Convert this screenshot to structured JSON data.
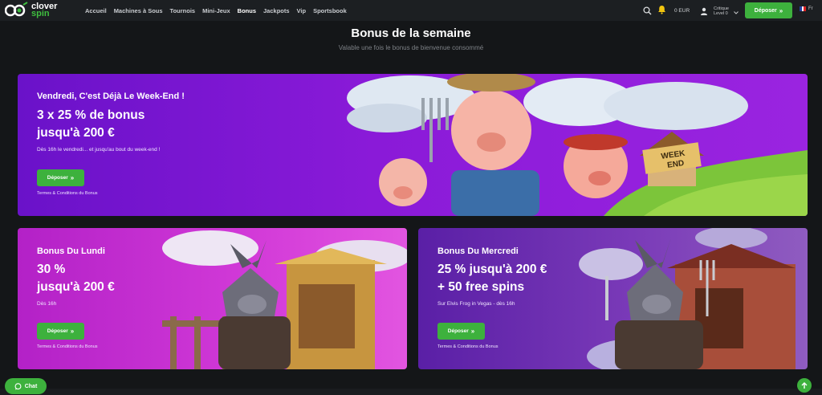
{
  "brand": {
    "line1": "clover",
    "line2": "spin"
  },
  "nav": {
    "items": [
      {
        "label": "Accueil",
        "active": false
      },
      {
        "label": "Machines à Sous",
        "active": false
      },
      {
        "label": "Tournois",
        "active": false
      },
      {
        "label": "Mini-Jeux",
        "active": false
      },
      {
        "label": "Bonus",
        "active": true
      },
      {
        "label": "Jackpots",
        "active": false
      },
      {
        "label": "Vip",
        "active": false
      },
      {
        "label": "Sportsbook",
        "active": false
      }
    ],
    "balance": "0 EUR",
    "user_name": "Critique",
    "user_level": "Level 0",
    "deposit_label": "Déposer",
    "language": "Fr",
    "icons": [
      "search-icon",
      "bell-icon",
      "user-icon",
      "chevron-down-icon"
    ]
  },
  "page": {
    "title": "Bonus de la semaine",
    "subtitle": "Valable une fois le bonus de bienvenue consommé"
  },
  "cards": [
    {
      "heading": "Vendredi, C'est Déjà Le Week-End !",
      "offer_line1": "3 x 25 % de bonus",
      "offer_line2": "jusqu'à 200 €",
      "note": "Dès 16h le vendredi... et jusqu'au bout du week-end !",
      "button": "Déposer",
      "terms": "Termes & Conditions du Bonus",
      "sign_line1": "WEEK",
      "sign_line2": "END"
    },
    {
      "heading": "Bonus Du Lundi",
      "offer_line1": "30 %",
      "offer_line2": "jusqu'à 200 €",
      "note": "Dès 16h",
      "button": "Déposer",
      "terms": "Termes & Conditions du Bonus"
    },
    {
      "heading": "Bonus Du Mercredi",
      "offer_line1": "25 % jusqu'à 200 €",
      "offer_line2": "+ 50 free spins",
      "note": "Sur Elvis Frog in Vegas - dès 16h",
      "button": "Déposer",
      "terms": "Termes & Conditions du Bonus"
    }
  ],
  "chat_label": "Chat",
  "colors": {
    "accent": "#3db13d",
    "nav_bg": "#1c1f22",
    "page_bg": "#141618"
  }
}
